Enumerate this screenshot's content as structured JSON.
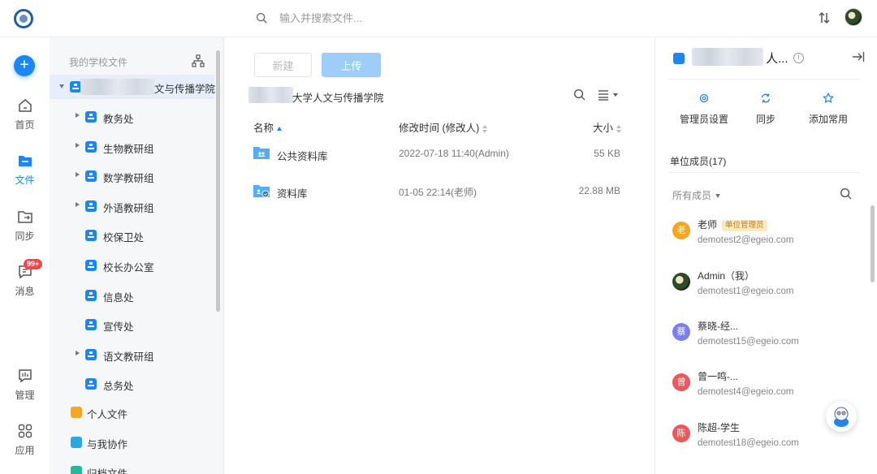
{
  "topbar": {
    "search_placeholder": "输入并搜索文件..."
  },
  "rail": {
    "add_label": "+",
    "home": "首页",
    "files": "文件",
    "sync": "同步",
    "messages": "消息",
    "messages_badge": "99+",
    "manage": "管理",
    "apps": "应用"
  },
  "tree": {
    "header": "我的学校文件",
    "root_suffix": "文与传播学院",
    "items": [
      {
        "label": "教务处",
        "expandable": true
      },
      {
        "label": "生物教研组",
        "expandable": true
      },
      {
        "label": "数学教研组",
        "expandable": true
      },
      {
        "label": "外语教研组",
        "expandable": true
      },
      {
        "label": "校保卫处",
        "expandable": false
      },
      {
        "label": "校长办公室",
        "expandable": false
      },
      {
        "label": "信息处",
        "expandable": false
      },
      {
        "label": "宣传处",
        "expandable": false
      },
      {
        "label": "语文教研组",
        "expandable": true
      },
      {
        "label": "总务处",
        "expandable": false
      }
    ],
    "personal": "个人文件",
    "collab": "与我协作",
    "archive": "归档文件"
  },
  "main": {
    "new_label": "新建",
    "upload_label": "上传",
    "breadcrumb": "大学人文与传播学院",
    "columns": {
      "name": "名称",
      "modified": "修改时间 (修改人)",
      "size": "大小"
    },
    "files": [
      {
        "name": "公共资料库",
        "modified": "2022-07-18 11:40(Admin)",
        "size": "55 KB"
      },
      {
        "name": "资料库",
        "modified": "01-05 22:14(老师)",
        "size": "22.88 MB"
      }
    ]
  },
  "right": {
    "title_suffix": "人...",
    "actions": [
      "管理员设置",
      "同步",
      "添加常用"
    ],
    "members_header": "单位成员(17)",
    "filter_label": "所有成员",
    "members": [
      {
        "name": "老师",
        "email": "demotest2@egeio.com",
        "avatar": "老",
        "color": "#f5a623",
        "tag": "单位管理员"
      },
      {
        "name": "Admin（我）",
        "email": "demotest1@egeio.com",
        "avatar": "",
        "color": "#2f4a25",
        "tag": ""
      },
      {
        "name": "蔡晓-经...",
        "email": "demotest15@egeio.com",
        "avatar": "蔡",
        "color": "#7b7ff0",
        "tag": ""
      },
      {
        "name": "曾一鸣-...",
        "email": "demotest4@egeio.com",
        "avatar": "曾",
        "color": "#ee5858",
        "tag": ""
      },
      {
        "name": "陈超-学生",
        "email": "demotest18@egeio.com",
        "avatar": "陈",
        "color": "#ee5858",
        "tag": ""
      }
    ]
  }
}
